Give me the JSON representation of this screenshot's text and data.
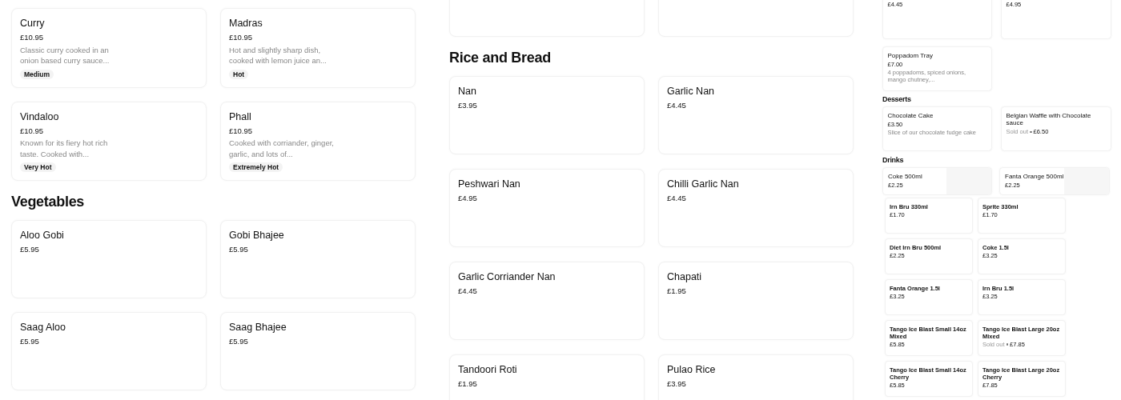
{
  "columns": [
    {
      "sections": [
        {
          "items": [
            {
              "kind": "card",
              "name": "Curry",
              "price": "£10.95",
              "description": "Classic curry cooked in an onion based curry sauce...",
              "tag": "Medium"
            },
            {
              "kind": "card",
              "name": "Madras",
              "price": "£10.95",
              "description": "Hot and slightly sharp dish, cooked with lemon juice an...",
              "tag": "Hot"
            },
            {
              "kind": "card",
              "name": "Vindaloo",
              "price": "£10.95",
              "description": "Known for its fiery hot rich taste. Cooked with...",
              "tag": "Very Hot"
            },
            {
              "kind": "card",
              "name": "Phall",
              "price": "£10.95",
              "description": "Cooked with corriander, ginger, garlic, and lots of...",
              "tag": "Extremely Hot"
            }
          ]
        },
        {
          "heading": "Vegetables",
          "items": [
            {
              "kind": "card",
              "name": "Aloo Gobi",
              "price": "£5.95"
            },
            {
              "kind": "card",
              "name": "Gobi Bhajee",
              "price": "£5.95"
            },
            {
              "kind": "card",
              "name": "Saag Aloo",
              "price": "£5.95"
            },
            {
              "kind": "card",
              "name": "Saag Bhajee",
              "price": "£5.95"
            }
          ]
        }
      ]
    },
    {
      "sections": [
        {
          "items": [
            {
              "kind": "card"
            },
            {
              "kind": "card"
            }
          ]
        },
        {
          "heading": "Rice and Bread",
          "items": [
            {
              "kind": "card",
              "name": "Nan",
              "price": "£3.95"
            },
            {
              "kind": "card",
              "name": "Garlic Nan",
              "price": "£4.45"
            },
            {
              "kind": "card",
              "name": "Peshwari Nan",
              "price": "£4.95"
            },
            {
              "kind": "card",
              "name": "Chilli Garlic Nan",
              "price": "£4.45"
            },
            {
              "kind": "card",
              "name": "Garlic Corriander Nan",
              "price": "£4.45"
            },
            {
              "kind": "card",
              "name": "Chapati",
              "price": "£1.95"
            },
            {
              "kind": "card",
              "name": "Tandoori Roti",
              "price": "£1.95"
            },
            {
              "kind": "card",
              "name": "Pulao Rice",
              "price": "£3.95"
            }
          ]
        }
      ]
    },
    {
      "sections": [
        {
          "items": [
            {
              "kind": "card",
              "price": "£4.45"
            },
            {
              "kind": "card",
              "price": "£4.95"
            },
            {
              "kind": "card",
              "name": "Poppadom Tray",
              "price": "£7.00",
              "description": "4 poppadoms, spiced onions, mango chutney,..."
            }
          ]
        },
        {
          "heading": "Desserts",
          "items": [
            {
              "kind": "card",
              "name": "Chocolate Cake",
              "price": "£3.50",
              "description": "Slice of our chocolate fudge cake"
            },
            {
              "kind": "card",
              "name": "Belgian Waffle with Chocolate sauce",
              "status": "Sold out",
              "price": "£6.50"
            }
          ]
        },
        {
          "heading": "Drinks",
          "items": [
            {
              "kind": "image-card",
              "name": "Coke 500ml",
              "price": "£2.25"
            },
            {
              "kind": "image-card",
              "name": "Fanta Orange 500ml",
              "price": "£2.25"
            },
            {
              "kind": "compact",
              "name": "Irn Bru 330ml",
              "price": "£1.70"
            },
            {
              "kind": "compact",
              "name": "Sprite 330ml",
              "price": "£1.70"
            },
            {
              "kind": "compact",
              "name": "Diet Irn Bru 500ml",
              "price": "£2.25"
            },
            {
              "kind": "compact",
              "name": "Coke 1.5l",
              "price": "£3.25"
            },
            {
              "kind": "compact",
              "name": "Fanta Orange 1.5l",
              "price": "£3.25"
            },
            {
              "kind": "compact",
              "name": "Irn Bru 1.5l",
              "price": "£3.25"
            },
            {
              "kind": "compact",
              "name": "Tango Ice Blast  Small 14oz Mixed",
              "price": "£5.85"
            },
            {
              "kind": "compact",
              "name": "Tango Ice Blast Large 20oz Mixed",
              "status": "Sold out",
              "price": "£7.85"
            },
            {
              "kind": "compact",
              "name": "Tango Ice Blast Small 14oz Cherry",
              "price": "£5.85"
            },
            {
              "kind": "compact",
              "name": "Tango Ice Blast Large 20oz Cherry",
              "price": "£7.85"
            }
          ]
        }
      ]
    }
  ]
}
